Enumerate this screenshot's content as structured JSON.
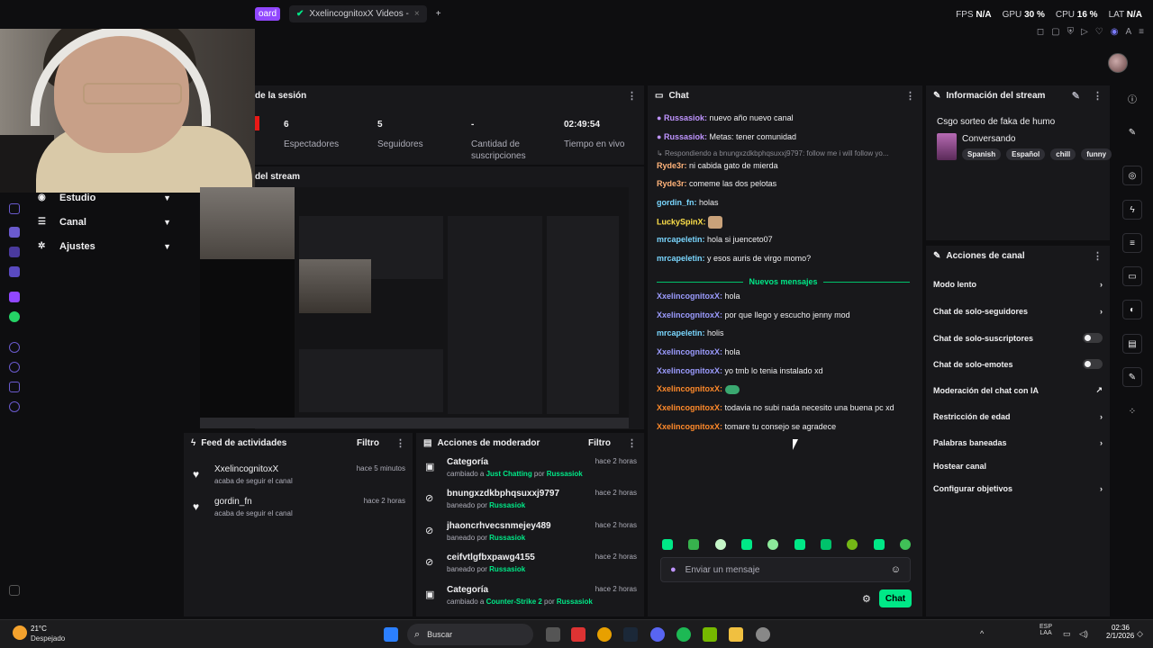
{
  "browser": {
    "tab_partial": "oard",
    "tab_active": "XxelincognitoxX Videos - ",
    "new_tab": "+"
  },
  "perf": {
    "fps_label": "FPS",
    "fps_value": "N/A",
    "gpu_label": "GPU",
    "gpu_value": "30 %",
    "cpu_label": "CPU",
    "cpu_value": "16 %",
    "lat_label": "LAT",
    "lat_value": "N/A"
  },
  "leftnav": {
    "items": [
      {
        "label": "Estudio"
      },
      {
        "label": "Canal"
      },
      {
        "label": "Ajustes"
      }
    ]
  },
  "session": {
    "title": "de la sesión",
    "stats": [
      {
        "value": "6",
        "label": "Espectadores"
      },
      {
        "value": "5",
        "label": "Seguidores"
      },
      {
        "value": "-",
        "label": "Cantidad de suscripciones"
      },
      {
        "value": "02:49:54",
        "label": "Tiempo en vivo"
      }
    ]
  },
  "preview": {
    "title": "del stream"
  },
  "chat": {
    "title": "Chat",
    "messages": [
      {
        "user": "Russasiok",
        "color": "#bf94ff",
        "text": "nuevo año nuevo canal",
        "badge": true
      },
      {
        "user": "Russasiok",
        "color": "#bf94ff",
        "text": "Metas: tener comunidad",
        "badge": true
      },
      {
        "reply": "Respondiendo a bnungxzdkbphqsuxxj9797: follow me i will follow yo..."
      },
      {
        "user": "Ryde3r",
        "color": "#ffb37a",
        "text": "ni cabida gato de mierda"
      },
      {
        "user": "Ryde3r",
        "color": "#ffb37a",
        "text": "comeme las dos pelotas"
      },
      {
        "user": "gordin_fn",
        "color": "#7ad7ff",
        "text": "holas"
      },
      {
        "user": "LuckySpinX",
        "color": "#ffe14a",
        "text": "",
        "emote": true
      },
      {
        "user": "mrcapeletin",
        "color": "#7ad7ff",
        "text": "hola si juenceto07"
      },
      {
        "user": "mrcapeletin",
        "color": "#7ad7ff",
        "text": "y esos auris de virgo momo?"
      },
      {
        "user": "XxelincognitoxX",
        "color": "#9c9cff",
        "text": "hola"
      },
      {
        "user": "XxelincognitoxX",
        "color": "#9c9cff",
        "text": "por que llego y escucho jenny mod"
      },
      {
        "user": "mrcapeletin",
        "color": "#7ad7ff",
        "text": "holis"
      },
      {
        "user": "XxelincognitoxX",
        "color": "#9c9cff",
        "text": "hola"
      },
      {
        "user": "XxelincognitoxX",
        "color": "#9c9cff",
        "text": "yo tmb lo tenia instalado xd"
      },
      {
        "user": "XxelincognitoxX",
        "color": "#ff8a2b",
        "text": "",
        "emote": true
      },
      {
        "user": "XxelincognitoxX",
        "color": "#ff8a2b",
        "text": "todavia no subi nada necesito una buena pc xd"
      },
      {
        "user": "XxelincognitoxX",
        "color": "#ff8a2b",
        "text": "tomare tu consejo se agradece"
      }
    ],
    "new_messages": "Nuevos mensajes",
    "input_placeholder": "Enviar un mensaje",
    "send_label": "Chat"
  },
  "stream_info": {
    "title": "Información del stream",
    "stream_title": "Csgo sorteo de faka de humo",
    "category": "Conversando",
    "tags": [
      "Spanish",
      "Español",
      "chill",
      "funny"
    ]
  },
  "channel_actions": {
    "title": "Acciones de canal",
    "items": [
      {
        "label": "Modo lento",
        "kind": "chevron"
      },
      {
        "label": "Chat de solo-seguidores",
        "kind": "chevron"
      },
      {
        "label": "Chat de solo-suscriptores",
        "kind": "toggle"
      },
      {
        "label": "Chat de solo-emotes",
        "kind": "toggle"
      },
      {
        "label": "Moderación del chat con IA",
        "kind": "external"
      },
      {
        "label": "Restricción de edad",
        "kind": "chevron"
      },
      {
        "label": "Palabras baneadas",
        "kind": "chevron"
      },
      {
        "label": "Hostear canal",
        "kind": "none"
      },
      {
        "label": "Configurar objetivos",
        "kind": "chevron"
      }
    ]
  },
  "activity_feed": {
    "title": "Feed de actividades",
    "filter": "Filtro",
    "items": [
      {
        "name": "XxelincognitoxX",
        "sub": "acaba de seguir el canal",
        "time": "hace 5 minutos"
      },
      {
        "name": "gordin_fn",
        "sub": "acaba de seguir el canal",
        "time": "hace 2 horas"
      }
    ]
  },
  "mod_actions": {
    "title": "Acciones de moderador",
    "filter": "Filtro",
    "items": [
      {
        "name": "Categoría",
        "pre": "cambiado a ",
        "hl": "Just Chatting",
        "mid": " por ",
        "by": "Russasiok",
        "time": "hace 2 horas",
        "icon": "category"
      },
      {
        "name": "bnungxzdkbphqsuxxj9797",
        "pre": "baneado por ",
        "hl": "",
        "mid": "",
        "by": "Russasiok",
        "time": "hace 2 horas",
        "icon": "ban"
      },
      {
        "name": "jhaoncrhvecsnmejey489",
        "pre": "baneado por ",
        "hl": "",
        "mid": "",
        "by": "Russasiok",
        "time": "hace 2 horas",
        "icon": "ban"
      },
      {
        "name": "ceifvtlgfbxpawg4155",
        "pre": "baneado por ",
        "hl": "",
        "mid": "",
        "by": "Russasiok",
        "time": "hace 2 horas",
        "icon": "ban"
      },
      {
        "name": "Categoría",
        "pre": "cambiado a ",
        "hl": "Counter-Strike 2",
        "mid": " por ",
        "by": "Russasiok",
        "time": "hace 2 horas",
        "icon": "category"
      }
    ]
  },
  "taskbar": {
    "weather_temp": "21°C",
    "weather_desc": "Despejado",
    "search": "Buscar",
    "lang": "ESP",
    "lang2": "LAA",
    "time": "02:36",
    "date": "2/1/2026"
  },
  "colors": {
    "accent": "#00e887",
    "bg": "#0e0e10",
    "panel": "#18181b"
  }
}
